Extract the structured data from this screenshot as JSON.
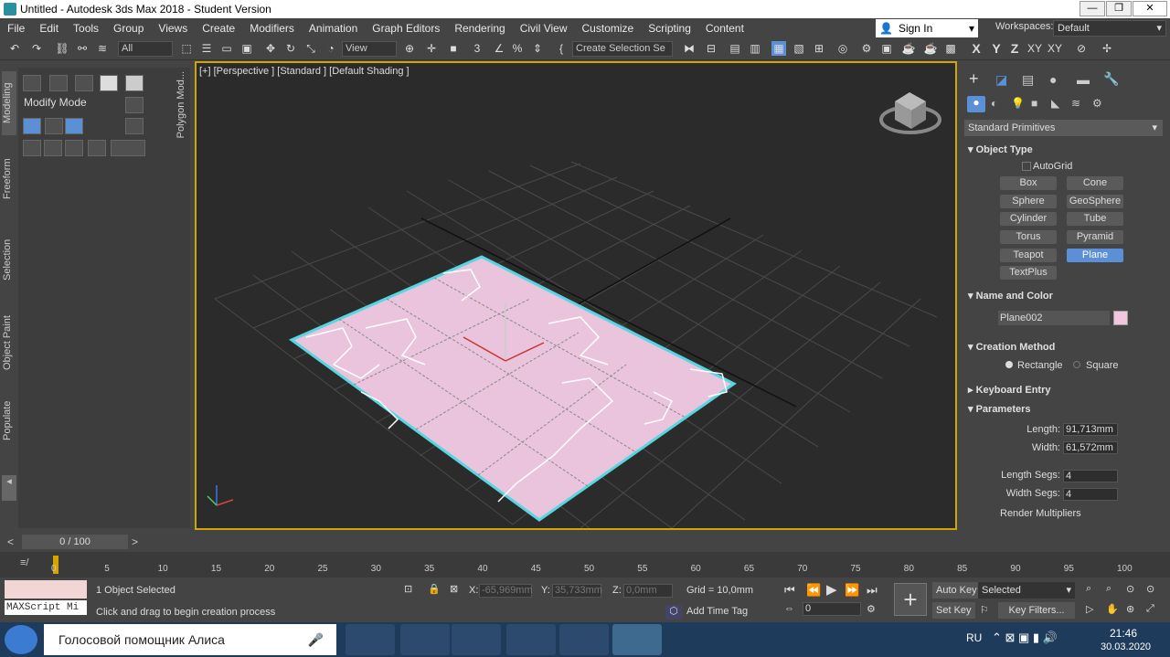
{
  "window": {
    "title": "Untitled - Autodesk 3ds Max 2018 - Student Version"
  },
  "menu": [
    "File",
    "Edit",
    "Tools",
    "Group",
    "Views",
    "Create",
    "Modifiers",
    "Animation",
    "Graph Editors",
    "Rendering",
    "Civil View",
    "Customize",
    "Scripting",
    "Content"
  ],
  "signin": {
    "label": "Sign In"
  },
  "workspaces": {
    "label": "Workspaces:",
    "value": "Default"
  },
  "toolbar": {
    "selection_filter": "All",
    "ref_coord": "View",
    "named_selection": "Create Selection Se",
    "axis_labels": [
      "X",
      "Y",
      "Z",
      "XY",
      "XY"
    ]
  },
  "sidetabs": [
    "Modeling",
    "Freeform",
    "Selection",
    "Object Paint",
    "Populate"
  ],
  "ribbon": {
    "mode": "Modify Mode",
    "panel_title": "Polygon Mod..."
  },
  "viewport": {
    "label": "[+] [Perspective ] [Standard ] [Default Shading ]"
  },
  "command_panel": {
    "category": "Standard Primitives",
    "object_type_title": "Object Type",
    "autogrid": "AutoGrid",
    "buttons": [
      "Box",
      "Cone",
      "Sphere",
      "GeoSphere",
      "Cylinder",
      "Tube",
      "Torus",
      "Pyramid",
      "Teapot",
      "Plane",
      "TextPlus"
    ],
    "active_button": "Plane",
    "name_color_title": "Name and Color",
    "object_name": "Plane002",
    "object_color": "#f2c6df",
    "creation_method_title": "Creation Method",
    "creation_options": [
      "Rectangle",
      "Square"
    ],
    "creation_selected": "Rectangle",
    "keyboard_entry_title": "Keyboard Entry",
    "parameters_title": "Parameters",
    "length_label": "Length:",
    "length_value": "91,713mm",
    "width_label": "Width:",
    "width_value": "61,572mm",
    "length_segs_label": "Length Segs:",
    "length_segs_value": "4",
    "width_segs_label": "Width Segs:",
    "width_segs_value": "4",
    "render_mult_title": "Render Multipliers"
  },
  "timeline": {
    "frame_counter": "0 / 100",
    "ticks": [
      "0",
      "5",
      "10",
      "15",
      "20",
      "25",
      "30",
      "35",
      "40",
      "45",
      "50",
      "55",
      "60",
      "65",
      "70",
      "75",
      "80",
      "85",
      "90",
      "95",
      "100"
    ]
  },
  "status": {
    "maxscript": "MAXScript Mi",
    "selection": "1 Object Selected",
    "prompt": "Click and drag to begin creation process",
    "x_label": "X:",
    "x_value": "-65,969mm",
    "y_label": "Y:",
    "y_value": "35,733mm",
    "z_label": "Z:",
    "z_value": "0,0mm",
    "grid": "Grid = 10,0mm",
    "add_time_tag": "Add Time Tag",
    "auto_key": "Auto Key",
    "set_key": "Set Key",
    "key_mode": "Selected",
    "key_filters": "Key Filters...",
    "current_frame": "0"
  },
  "taskbar": {
    "search_text": "Голосовой помощник Алиса",
    "language": "RU",
    "time": "21:46",
    "date": "30.03.2020"
  }
}
